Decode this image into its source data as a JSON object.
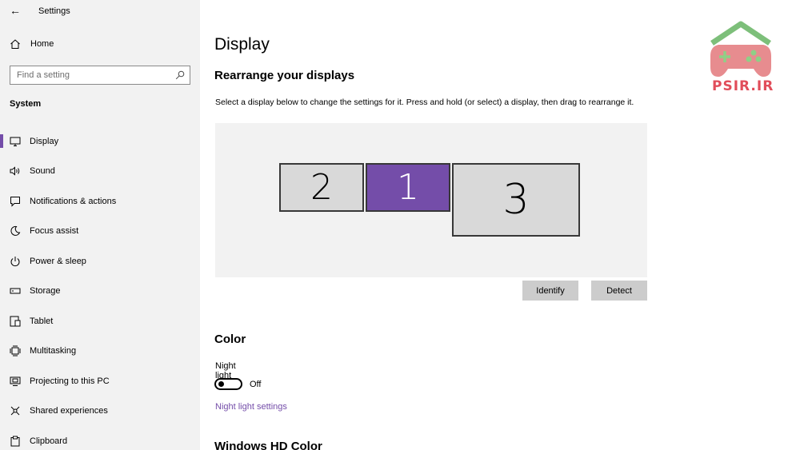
{
  "window": {
    "title": "Settings"
  },
  "sidebar": {
    "home_label": "Home",
    "search_placeholder": "Find a setting",
    "section": "System",
    "items": [
      {
        "label": "Display",
        "icon": "monitor-icon",
        "active": true
      },
      {
        "label": "Sound",
        "icon": "speaker-icon"
      },
      {
        "label": "Notifications & actions",
        "icon": "notification-icon"
      },
      {
        "label": "Focus assist",
        "icon": "moon-icon"
      },
      {
        "label": "Power & sleep",
        "icon": "power-icon"
      },
      {
        "label": "Storage",
        "icon": "storage-icon"
      },
      {
        "label": "Tablet",
        "icon": "tablet-icon"
      },
      {
        "label": "Multitasking",
        "icon": "multitasking-icon"
      },
      {
        "label": "Projecting to this PC",
        "icon": "projecting-icon"
      },
      {
        "label": "Shared experiences",
        "icon": "shared-icon"
      },
      {
        "label": "Clipboard",
        "icon": "clipboard-icon"
      }
    ]
  },
  "main": {
    "title": "Display",
    "arrange_heading": "Rearrange your displays",
    "arrange_desc": "Select a display below to change the settings for it. Press and hold (or select) a display, then drag to rearrange it.",
    "displays": [
      {
        "label": "2",
        "selected": false
      },
      {
        "label": "1",
        "selected": true
      },
      {
        "label": "3",
        "selected": false
      }
    ],
    "identify_label": "Identify",
    "detect_label": "Detect",
    "color_heading": "Color",
    "night_light_label": "Night light",
    "night_light_state": "Off",
    "night_light_settings_link": "Night light settings",
    "hd_color_heading": "Windows HD Color"
  },
  "watermark": {
    "text": "PSIR.IR"
  },
  "colors": {
    "accent": "#744da9",
    "sidebar_bg": "#f2f2f2",
    "canvas_bg": "#f2f2f2",
    "monitor_bg": "#d9d9d9",
    "button_bg": "#cccccc"
  }
}
